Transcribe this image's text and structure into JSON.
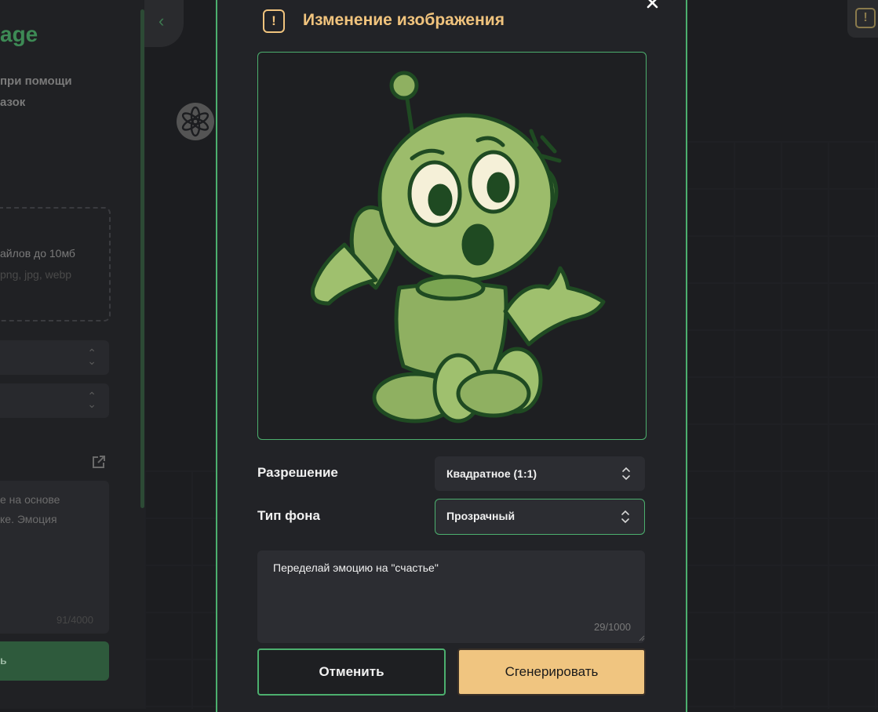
{
  "background": {
    "title_fragment": "age",
    "subtitle_fragment_1": "при помощи",
    "subtitle_fragment_2": "азок",
    "upload_hint": "айлов до 10мб",
    "upload_formats": "png, jpg, webp",
    "select1_value": "",
    "select2_value": "",
    "text_fragment_1": "е на основе",
    "text_fragment_2": "ке. Эмоция",
    "text_counter": "91/4000",
    "generate_fragment": "ь"
  },
  "modal": {
    "title": "Изменение изображения",
    "header_icon": "!",
    "resolution_label": "Разрешение",
    "resolution_value": "Квадратное (1:1)",
    "background_label": "Тип фона",
    "background_value": "Прозрачный",
    "prompt_value": "Переделай эмоцию на \"счастье\"",
    "prompt_counter": "29/1000",
    "cancel_label": "Отменить",
    "generate_label": "Сгенерировать"
  },
  "colors": {
    "accent_green": "#4caf6e",
    "accent_gold": "#f0c37d",
    "button_gold": "#f0c580"
  }
}
